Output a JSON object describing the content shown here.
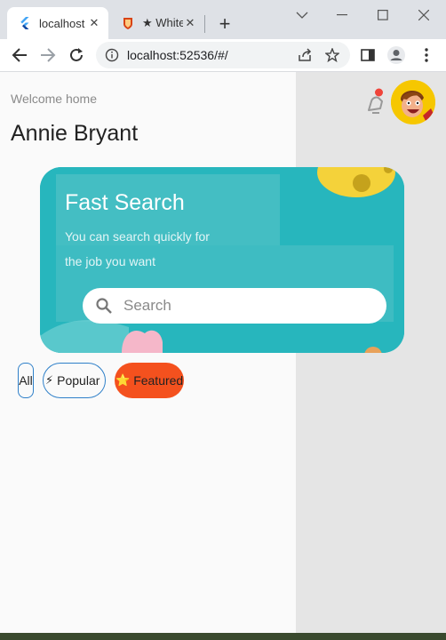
{
  "browser": {
    "tabs": [
      {
        "title": "localhost",
        "active": true,
        "icon": "flutter-icon"
      },
      {
        "title": "★ White",
        "active": false,
        "icon": "shield-favicon-icon"
      }
    ],
    "address": {
      "url": "localhost:52536/#/"
    }
  },
  "page": {
    "welcome": "Welcome home",
    "user_name": "Annie Bryant",
    "banner": {
      "title": "Fast Search",
      "subtitle_line1": "You can search quickly for",
      "subtitle_line2": "the job you want",
      "search_placeholder": "Search",
      "color": "#27b6bd"
    },
    "filters": [
      {
        "label": "All",
        "emoji": ""
      },
      {
        "label": "Popular",
        "emoji": "⚡"
      },
      {
        "label": "Featured",
        "emoji": "⭐"
      }
    ],
    "colors": {
      "accent": "#f4511e",
      "chip_border": "#2f80c9"
    }
  }
}
